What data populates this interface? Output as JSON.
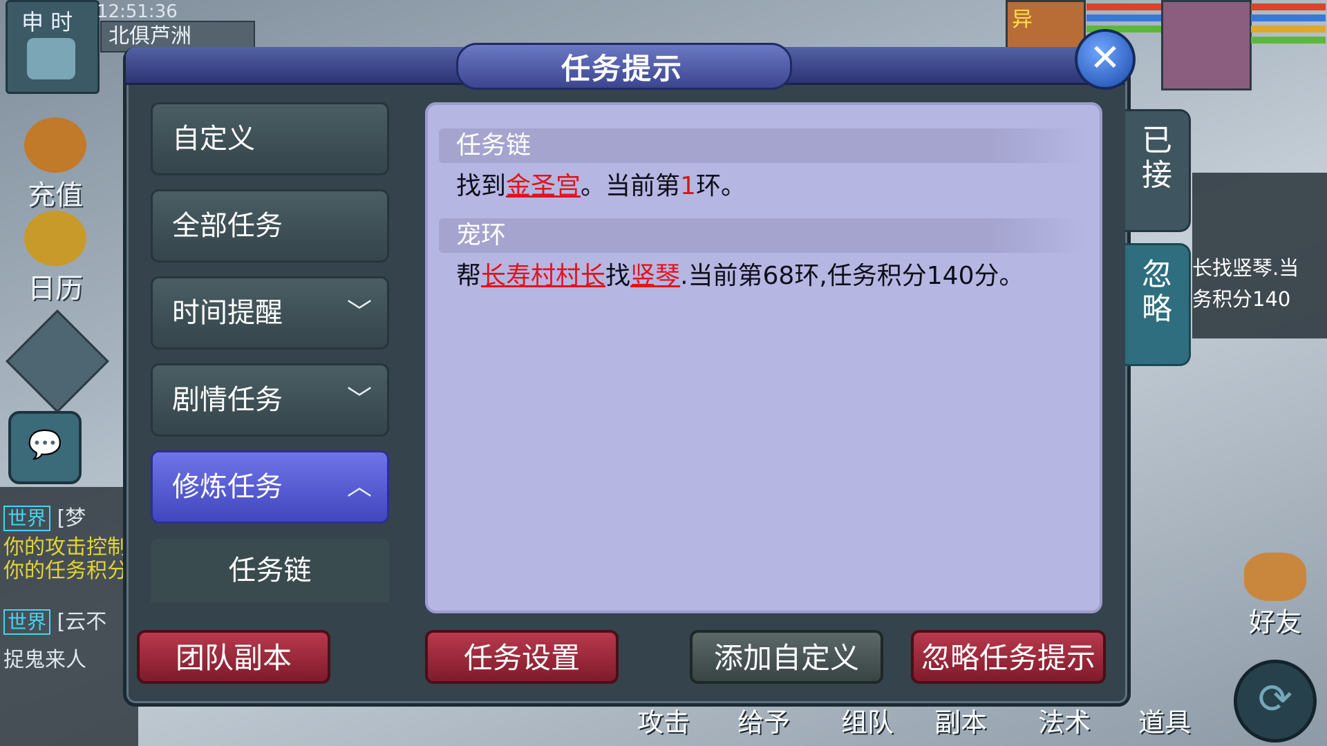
{
  "hud": {
    "clock_hour": "申 时",
    "time": "12:51:36",
    "map_name": "北俱芦洲",
    "recharge_label": "充值",
    "calendar_label": "日历",
    "chat_icon": "chat-bubble-icon",
    "chat_lines": [
      {
        "channel": "世界",
        "text": "[梦"
      },
      {
        "channel": "",
        "text": "你的攻击控制"
      },
      {
        "channel": "",
        "text": "你的任务积分"
      },
      {
        "channel": "世界",
        "text": "[云不"
      },
      {
        "channel": "",
        "text": "捉鬼来人"
      }
    ],
    "right_quest_text_1": "长找竖琴.当",
    "right_quest_text_2": "务积分140",
    "friend_label": "好友",
    "bottom_bar": [
      "攻击",
      "给予",
      "组队",
      "副本",
      "法术",
      "道具"
    ],
    "pet_badge": "异"
  },
  "dialog": {
    "title": "任务提示",
    "close_icon": "close-x-icon",
    "nav": [
      {
        "label": "自定义",
        "chevron": ""
      },
      {
        "label": "全部任务",
        "chevron": ""
      },
      {
        "label": "时间提醒",
        "chevron": "﹀"
      },
      {
        "label": "剧情任务",
        "chevron": "﹀"
      },
      {
        "label": "修炼任务",
        "chevron": "︿"
      }
    ],
    "nav_sub": "任务链",
    "sections": [
      {
        "title": "任务链",
        "body_pre": "找到",
        "link1": "金圣宫",
        "body_mid": "。当前第",
        "num": "1",
        "body_post": "环。"
      },
      {
        "title": "宠环",
        "body_pre": "帮",
        "link1": "长寿村村长",
        "body_mid": "找",
        "link2": "竖琴",
        "body_post": ".当前第68环,任务积分140分。"
      }
    ],
    "tabs": {
      "accepted": "已\n接",
      "ignore": "忽\n略"
    },
    "buttons": {
      "team_dungeon": "团队副本",
      "quest_settings": "任务设置",
      "add_custom": "添加自定义",
      "ignore_hints": "忽略任务提示"
    }
  }
}
